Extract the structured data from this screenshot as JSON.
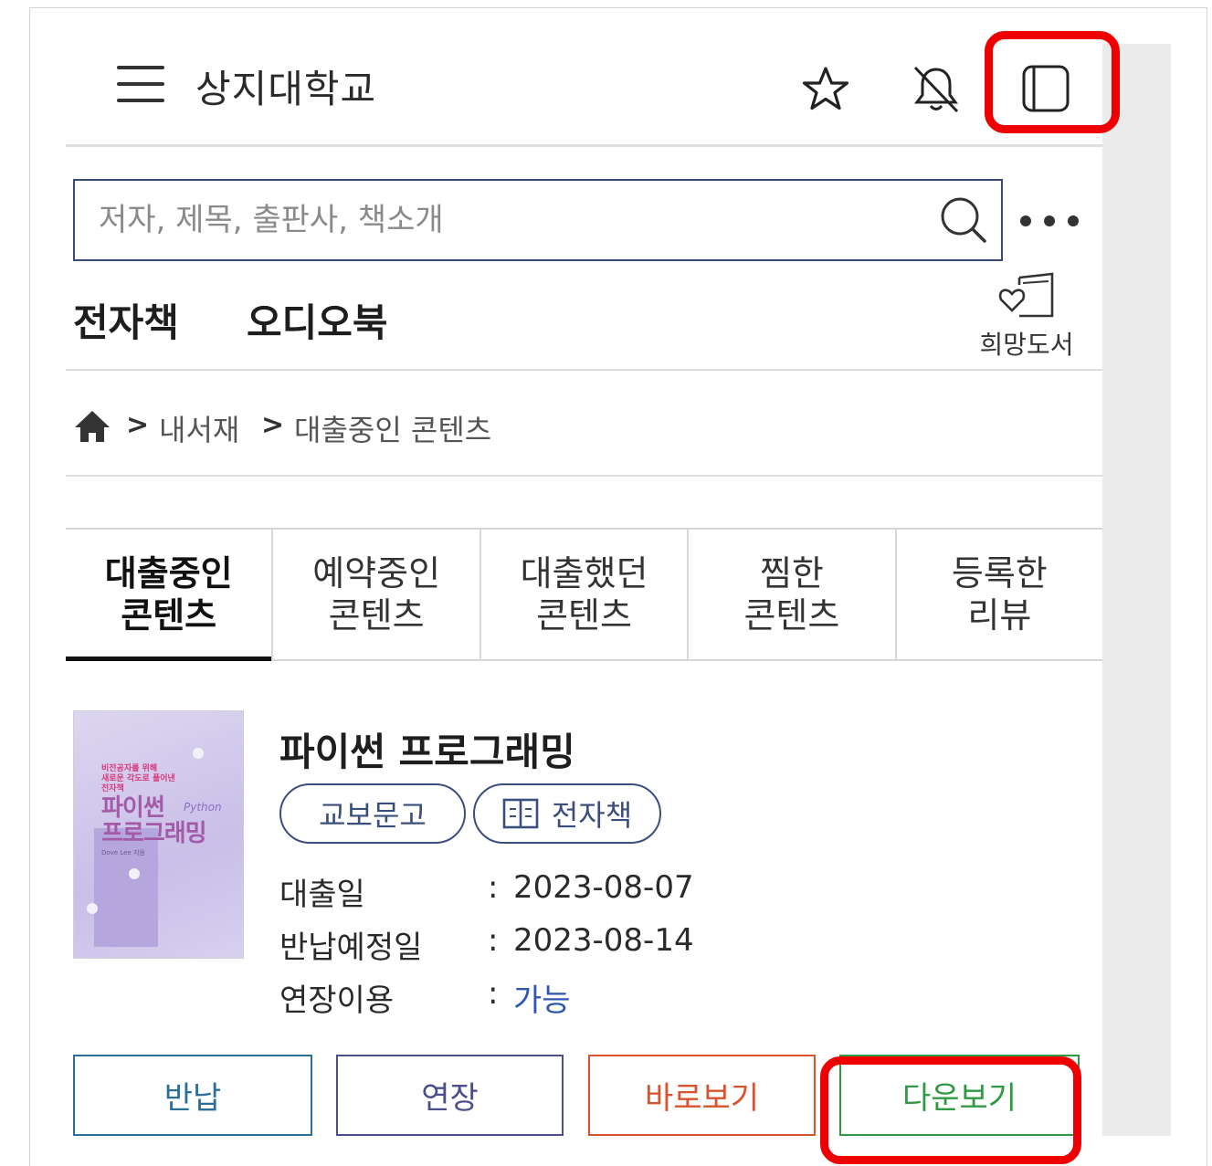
{
  "header": {
    "title": "상지대학교",
    "icons": [
      "menu-icon",
      "star-icon",
      "bell-off-icon",
      "tablet-icon"
    ]
  },
  "search": {
    "placeholder": "저자, 제목, 출판사, 책소개",
    "value": ""
  },
  "type_tabs": [
    "전자책",
    "오디오북"
  ],
  "wish": {
    "label": "희망도서"
  },
  "breadcrumb": [
    "내서재",
    "대출중인 콘텐츠"
  ],
  "lending_tabs": [
    {
      "line1": "대출중인",
      "line2": "콘텐츠",
      "active": true
    },
    {
      "line1": "예약중인",
      "line2": "콘텐츠",
      "active": false
    },
    {
      "line1": "대출했던",
      "line2": "콘텐츠",
      "active": false
    },
    {
      "line1": "찜한",
      "line2": "콘텐츠",
      "active": false
    },
    {
      "line1": "등록한",
      "line2": "리뷰",
      "active": false
    }
  ],
  "book": {
    "title": "파이썬 프로그래밍",
    "publisher": "교보문고",
    "format": "전자책",
    "cover": {
      "tagline1": "비전공자를 위해",
      "tagline2": "새로운 각도로 풀어낸",
      "tagline3": "전자책",
      "title1": "파이썬",
      "title2": "프로그래밍",
      "subtitle": "Python",
      "author": "Dove Lee 지음"
    },
    "info": [
      {
        "label": "대출일",
        "value": "2023-08-07"
      },
      {
        "label": "반납예정일",
        "value": "2023-08-14"
      },
      {
        "label": "연장이용",
        "value": "가능"
      }
    ],
    "colon": ":"
  },
  "actions": [
    {
      "label": "반납",
      "color": "#2a6f96"
    },
    {
      "label": "연장",
      "color": "#4a4f8c"
    },
    {
      "label": "바로보기",
      "color": "#d9532e"
    },
    {
      "label": "다운보기",
      "color": "#2f9a43"
    }
  ],
  "colors": {
    "highlight": "#ee0000",
    "link": "#2e56b4",
    "border": "#3b4a78"
  }
}
